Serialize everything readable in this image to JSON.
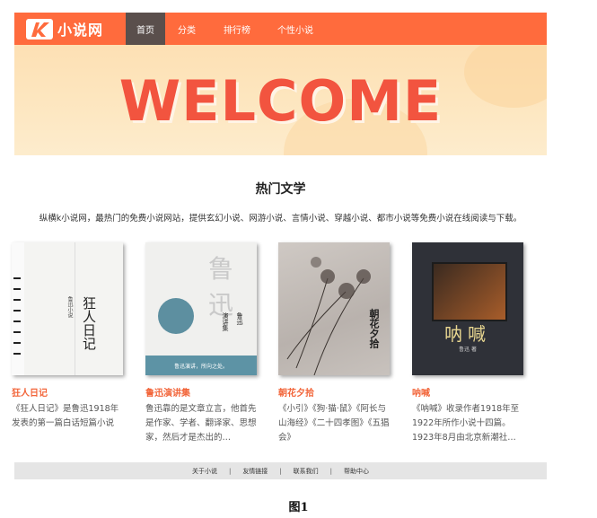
{
  "nav": {
    "logo_text": "小说网",
    "items": [
      {
        "label": "首页",
        "active": true
      },
      {
        "label": "分类"
      },
      {
        "label": "排行榜"
      },
      {
        "label": "个性小说"
      }
    ]
  },
  "banner": {
    "text": "WELCOME"
  },
  "main": {
    "title": "热门文学",
    "intro": "纵横k小说网，最热门的免费小说网站，提供玄幻小说、网游小说、言情小说、穿越小说、都市小说等免费小说在线阅读与下载。"
  },
  "books": [
    {
      "title": "狂人日记",
      "desc": "《狂人日记》是鲁迅1918年发表的第一篇白话短篇小说",
      "cover_text": "狂人日记",
      "cover_author": "鲁迅小说"
    },
    {
      "title": "鲁迅演讲集",
      "desc": "鲁迅靠的是文章立言，他首先是作家、学者、翻译家、思想家，然后才是杰出的…",
      "cover_big": "鲁迅",
      "cover_title": "演讲集",
      "cover_author": "鲁迅",
      "cover_slogan": "鲁迅演讲，所向之处。"
    },
    {
      "title": "朝花夕拾",
      "desc": "《小引》《狗·猫·鼠》《阿长与山海经》《二十四孝图》《五猖会》",
      "cover_text": "朝花夕拾"
    },
    {
      "title": "呐喊",
      "desc": "《呐喊》收录作者1918年至1922年所作小说十四篇。1923年8月由北京新潮社…",
      "cover_text": "呐喊",
      "cover_author": "鲁迅 著"
    }
  ],
  "footer": {
    "links": [
      "关于小说",
      "友情链接",
      "联系我们",
      "帮助中心"
    ]
  },
  "caption": "图1",
  "colors": {
    "accent": "#ff6b3d",
    "title_orange": "#f2653a",
    "welcome": "#f2543f"
  }
}
